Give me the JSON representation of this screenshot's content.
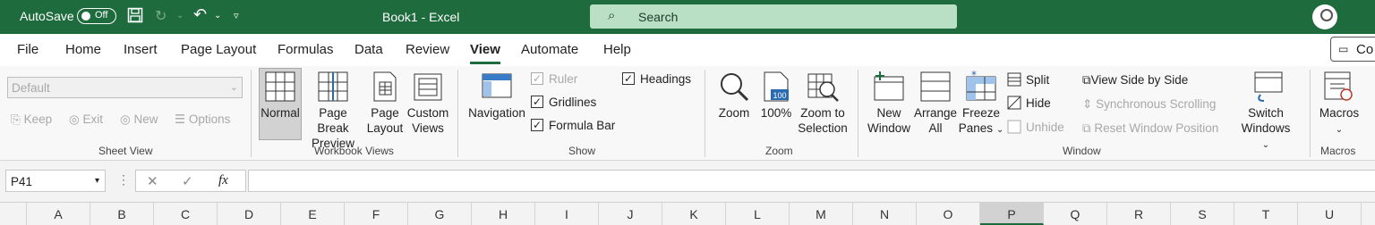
{
  "titlebar": {
    "autosave_label": "AutoSave",
    "autosave_state": "Off",
    "doc_title": "Book1  -  Excel",
    "search_placeholder": "Search"
  },
  "tabs": [
    "File",
    "Home",
    "Insert",
    "Page Layout",
    "Formulas",
    "Data",
    "Review",
    "View",
    "Automate",
    "Help"
  ],
  "active_tab": "View",
  "comments_label": "Co",
  "sheet_view": {
    "combo_value": "Default",
    "keep": "Keep",
    "exit": "Exit",
    "new": "New",
    "options": "Options",
    "group": "Sheet View"
  },
  "workbook_views": {
    "normal": "Normal",
    "page_break_1": "Page Break",
    "page_break_2": "Preview",
    "page_layout_1": "Page",
    "page_layout_2": "Layout",
    "custom_1": "Custom",
    "custom_2": "Views",
    "group": "Workbook Views"
  },
  "show": {
    "navigation": "Navigation",
    "ruler": "Ruler",
    "gridlines": "Gridlines",
    "formula_bar": "Formula Bar",
    "headings": "Headings",
    "group": "Show"
  },
  "zoom": {
    "zoom": "Zoom",
    "hundred": "100%",
    "hundred_icon": "100",
    "selection_1": "Zoom to",
    "selection_2": "Selection",
    "group": "Zoom"
  },
  "window": {
    "new_1": "New",
    "new_2": "Window",
    "arrange_1": "Arrange",
    "arrange_2": "All",
    "freeze_1": "Freeze",
    "freeze_2": "Panes",
    "split": "Split",
    "hide": "Hide",
    "unhide": "Unhide",
    "side_by_side": "View Side by Side",
    "sync_scroll": "Synchronous Scrolling",
    "reset_pos": "Reset Window Position",
    "switch_1": "Switch",
    "switch_2": "Windows",
    "group": "Window"
  },
  "macros": {
    "label": "Macros",
    "group": "Macros"
  },
  "formula_bar": {
    "name_box": "P41",
    "fx": "fx"
  },
  "columns": [
    "A",
    "B",
    "C",
    "D",
    "E",
    "F",
    "G",
    "H",
    "I",
    "J",
    "K",
    "L",
    "M",
    "N",
    "O",
    "P",
    "Q",
    "R",
    "S",
    "T",
    "U"
  ],
  "selected_column": "P"
}
